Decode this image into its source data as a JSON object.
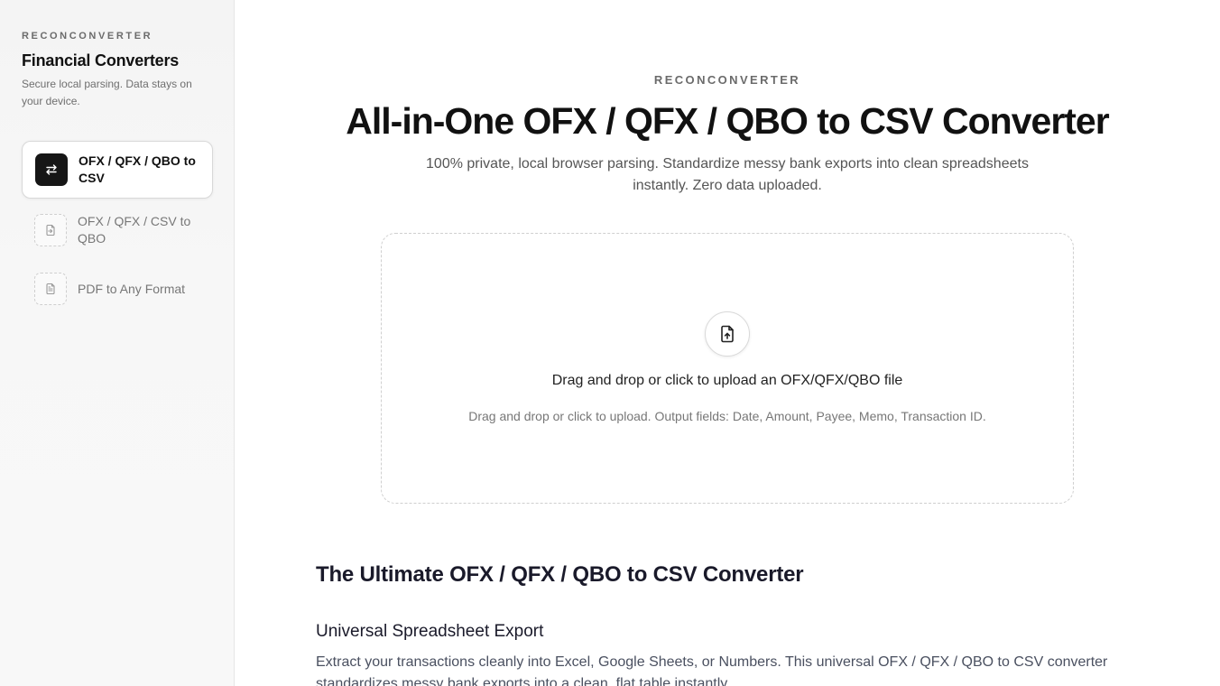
{
  "sidebar": {
    "brand": "RECONCONVERTER",
    "title": "Financial Converters",
    "subtitle": "Secure local parsing. Data stays on your device.",
    "items": [
      {
        "label": "OFX / QFX / QBO to CSV",
        "icon": "swap-arrows-icon",
        "active": true
      },
      {
        "label": "OFX / QFX / CSV to QBO",
        "icon": "file-import-icon",
        "active": false
      },
      {
        "label": "PDF to Any Format",
        "icon": "file-text-icon",
        "active": false
      }
    ]
  },
  "main": {
    "eyebrow": "RECONCONVERTER",
    "title": "All-in-One OFX / QFX / QBO to CSV Converter",
    "subtitle": "100% private, local browser parsing. Standardize messy bank exports into clean spreadsheets instantly. Zero data uploaded.",
    "dropzone": {
      "icon": "file-upload-icon",
      "title": "Drag and drop or click to upload an OFX/QFX/QBO file",
      "hint": "Drag and drop or click to upload. Output fields: Date, Amount, Payee, Memo, Transaction ID."
    },
    "section": {
      "heading": "The Ultimate OFX / QFX / QBO to CSV Converter",
      "subheading": "Universal Spreadsheet Export",
      "paragraph": "Extract your transactions cleanly into Excel, Google Sheets, or Numbers. This universal OFX / QFX / QBO to CSV converter standardizes messy bank exports into a clean, flat table instantly."
    }
  },
  "colors": {
    "accent": "#161616",
    "sidebar_bg": "#f6f6f6",
    "border": "#d8d8d8"
  }
}
